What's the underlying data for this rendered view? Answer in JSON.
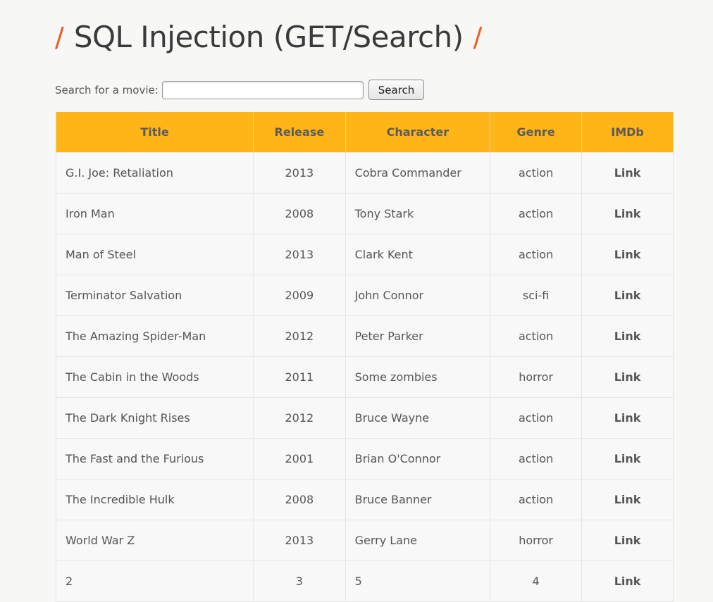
{
  "header": {
    "slash_left": "/",
    "title": "SQL Injection (GET/Search)",
    "slash_right": "/"
  },
  "search": {
    "label": "Search for a movie:",
    "value": "",
    "placeholder": "",
    "button_label": "Search"
  },
  "table": {
    "columns": [
      "Title",
      "Release",
      "Character",
      "Genre",
      "IMDb"
    ],
    "rows": [
      {
        "title": "G.I. Joe: Retaliation",
        "release": "2013",
        "character": "Cobra Commander",
        "genre": "action",
        "imdb": "Link"
      },
      {
        "title": "Iron Man",
        "release": "2008",
        "character": "Tony Stark",
        "genre": "action",
        "imdb": "Link"
      },
      {
        "title": "Man of Steel",
        "release": "2013",
        "character": "Clark Kent",
        "genre": "action",
        "imdb": "Link"
      },
      {
        "title": "Terminator Salvation",
        "release": "2009",
        "character": "John Connor",
        "genre": "sci-fi",
        "imdb": "Link"
      },
      {
        "title": "The Amazing Spider-Man",
        "release": "2012",
        "character": "Peter Parker",
        "genre": "action",
        "imdb": "Link"
      },
      {
        "title": "The Cabin in the Woods",
        "release": "2011",
        "character": "Some zombies",
        "genre": "horror",
        "imdb": "Link"
      },
      {
        "title": "The Dark Knight Rises",
        "release": "2012",
        "character": "Bruce Wayne",
        "genre": "action",
        "imdb": "Link"
      },
      {
        "title": "The Fast and the Furious",
        "release": "2001",
        "character": "Brian O'Connor",
        "genre": "action",
        "imdb": "Link"
      },
      {
        "title": "The Incredible Hulk",
        "release": "2008",
        "character": "Bruce Banner",
        "genre": "action",
        "imdb": "Link"
      },
      {
        "title": "World War Z",
        "release": "2013",
        "character": "Gerry Lane",
        "genre": "horror",
        "imdb": "Link"
      },
      {
        "title": "2",
        "release": "3",
        "character": "5",
        "genre": "4",
        "imdb": "Link"
      }
    ]
  },
  "colors": {
    "accent_slash": "#f05a23",
    "header_bg": "#ffb518",
    "page_bg": "#f7f7f5"
  }
}
